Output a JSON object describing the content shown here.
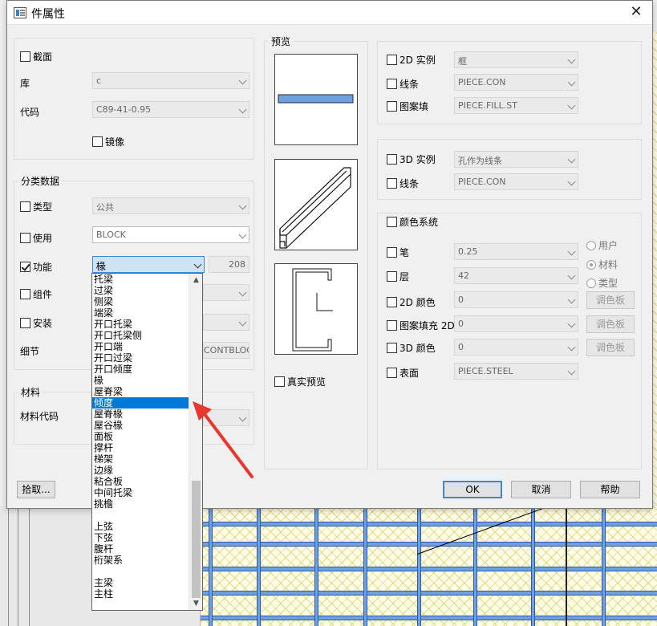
{
  "window": {
    "title": "件属性",
    "close": "✕"
  },
  "left": {
    "section_check": "截面",
    "lib_label": "库",
    "lib_value": "c",
    "code_label": "代码",
    "code_value": "C89-41-0.95",
    "mirror_label": "镜像",
    "classification_label": "分类数据",
    "type_label": "类型",
    "type_value": "公共",
    "use_label": "使用",
    "use_value": "BLOCK",
    "function_label": "功能",
    "function_value": "椽",
    "function_number": "208",
    "component_label": "组件",
    "install_label": "安装",
    "detail_label": "细节",
    "detail_value": "CONTBLOC",
    "material_group_label": "材料",
    "material_code_label": "材料代码",
    "pick_button": "拾取..."
  },
  "dropdown": {
    "items": [
      "托梁",
      "过梁",
      "侧梁",
      "端梁",
      "开口托梁",
      "开口托梁侧",
      "开口端",
      "开口过梁",
      "开口倾度",
      "椽",
      "屋脊梁",
      "倾度",
      "屋脊椽",
      "屋谷椽",
      "面板",
      "撑杆",
      "梯架",
      "边缘",
      "粘合板",
      "中间托梁",
      "挑檐",
      "",
      "上弦",
      "下弦",
      "腹杆",
      "桁架系",
      "",
      "主梁",
      "主柱"
    ],
    "selected_index": 11,
    "scroll_up": "▲",
    "scroll_down": "▼"
  },
  "preview": {
    "label": "预览",
    "real_preview_label": "真实预览"
  },
  "right": {
    "inst2d_label": "2D 实例",
    "inst2d_value": "框",
    "line1_label": "线条",
    "line1_value": "PIECE.CON",
    "pattern_label": "图案填",
    "pattern_value": "PIECE.FILL.ST",
    "inst3d_label": "3D 实例",
    "inst3d_value": "孔作为线条",
    "line2_label": "线条",
    "line2_value": "PIECE.CON",
    "color_system_label": "颜色系统",
    "pen_label": "笔",
    "pen_value": "0.25",
    "layer_label": "层",
    "layer_value": "42",
    "color2d_label": "2D 颜色",
    "color2d_value": "0",
    "patternfill2d_label": "图案填充 2D",
    "patternfill2d_value": "0",
    "color3d_label": "3D 颜色",
    "color3d_value": "0",
    "surface_label": "表面",
    "surface_value": "PIECE.STEEL",
    "radio_user": "用户",
    "radio_material": "材料",
    "radio_type": "类型",
    "palette1": "调色板",
    "palette2": "调色板",
    "palette3": "调色板"
  },
  "buttons": {
    "ok": "OK",
    "cancel": "取消",
    "help": "帮助"
  },
  "colors": {
    "accent": "#0078d7",
    "beam": "#6fa0e0",
    "arrow": "#e8372f"
  }
}
